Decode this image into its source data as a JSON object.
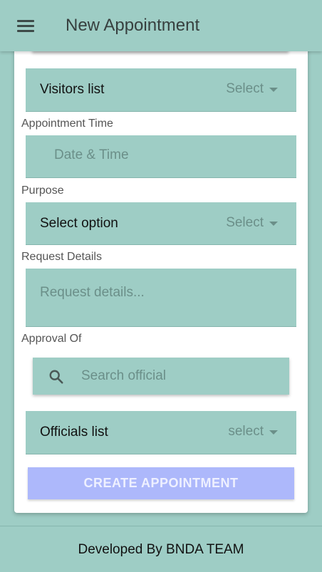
{
  "header": {
    "title": "New Appointment",
    "menu_icon": "menu-icon"
  },
  "form": {
    "visitors_list": {
      "label": "Visitors list",
      "select_text": "Select"
    },
    "appointment_time": {
      "label": "Appointment Time",
      "placeholder": "Date & Time"
    },
    "purpose": {
      "label": "Purpose",
      "field_label": "Select option",
      "select_text": "Select"
    },
    "request_details": {
      "label": "Request Details",
      "placeholder": "Request details..."
    },
    "approval_of": {
      "label": "Approval Of",
      "search_placeholder": "Search official",
      "search_icon": "search-icon"
    },
    "officials_list": {
      "label": "Officials list",
      "select_text": "select"
    },
    "create_button": "CREATE APPOINTMENT"
  },
  "footer": {
    "text": "Developed By BNDA TEAM"
  },
  "colors": {
    "primary": "#9ecdc5",
    "button": "#adb8fb",
    "card": "#ffffff"
  }
}
